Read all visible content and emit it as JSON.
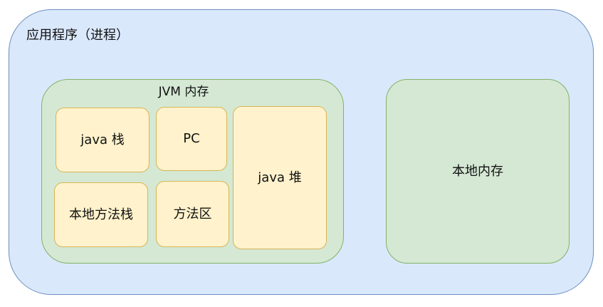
{
  "process": {
    "label": "应用程序（进程）"
  },
  "jvm_memory": {
    "label": "JVM 内存",
    "regions": {
      "java_stack": "java 栈",
      "pc": "PC",
      "java_heap": "java 堆",
      "native_method_stack": "本地方法栈",
      "method_area": "方法区"
    }
  },
  "native_memory": {
    "label": "本地内存"
  },
  "colors": {
    "process_fill": "#dae8fc",
    "process_border": "#6c8ebf",
    "memory_fill": "#d5e8d4",
    "memory_border": "#82b366",
    "region_fill": "#fff2cc",
    "region_border": "#d6b656"
  }
}
